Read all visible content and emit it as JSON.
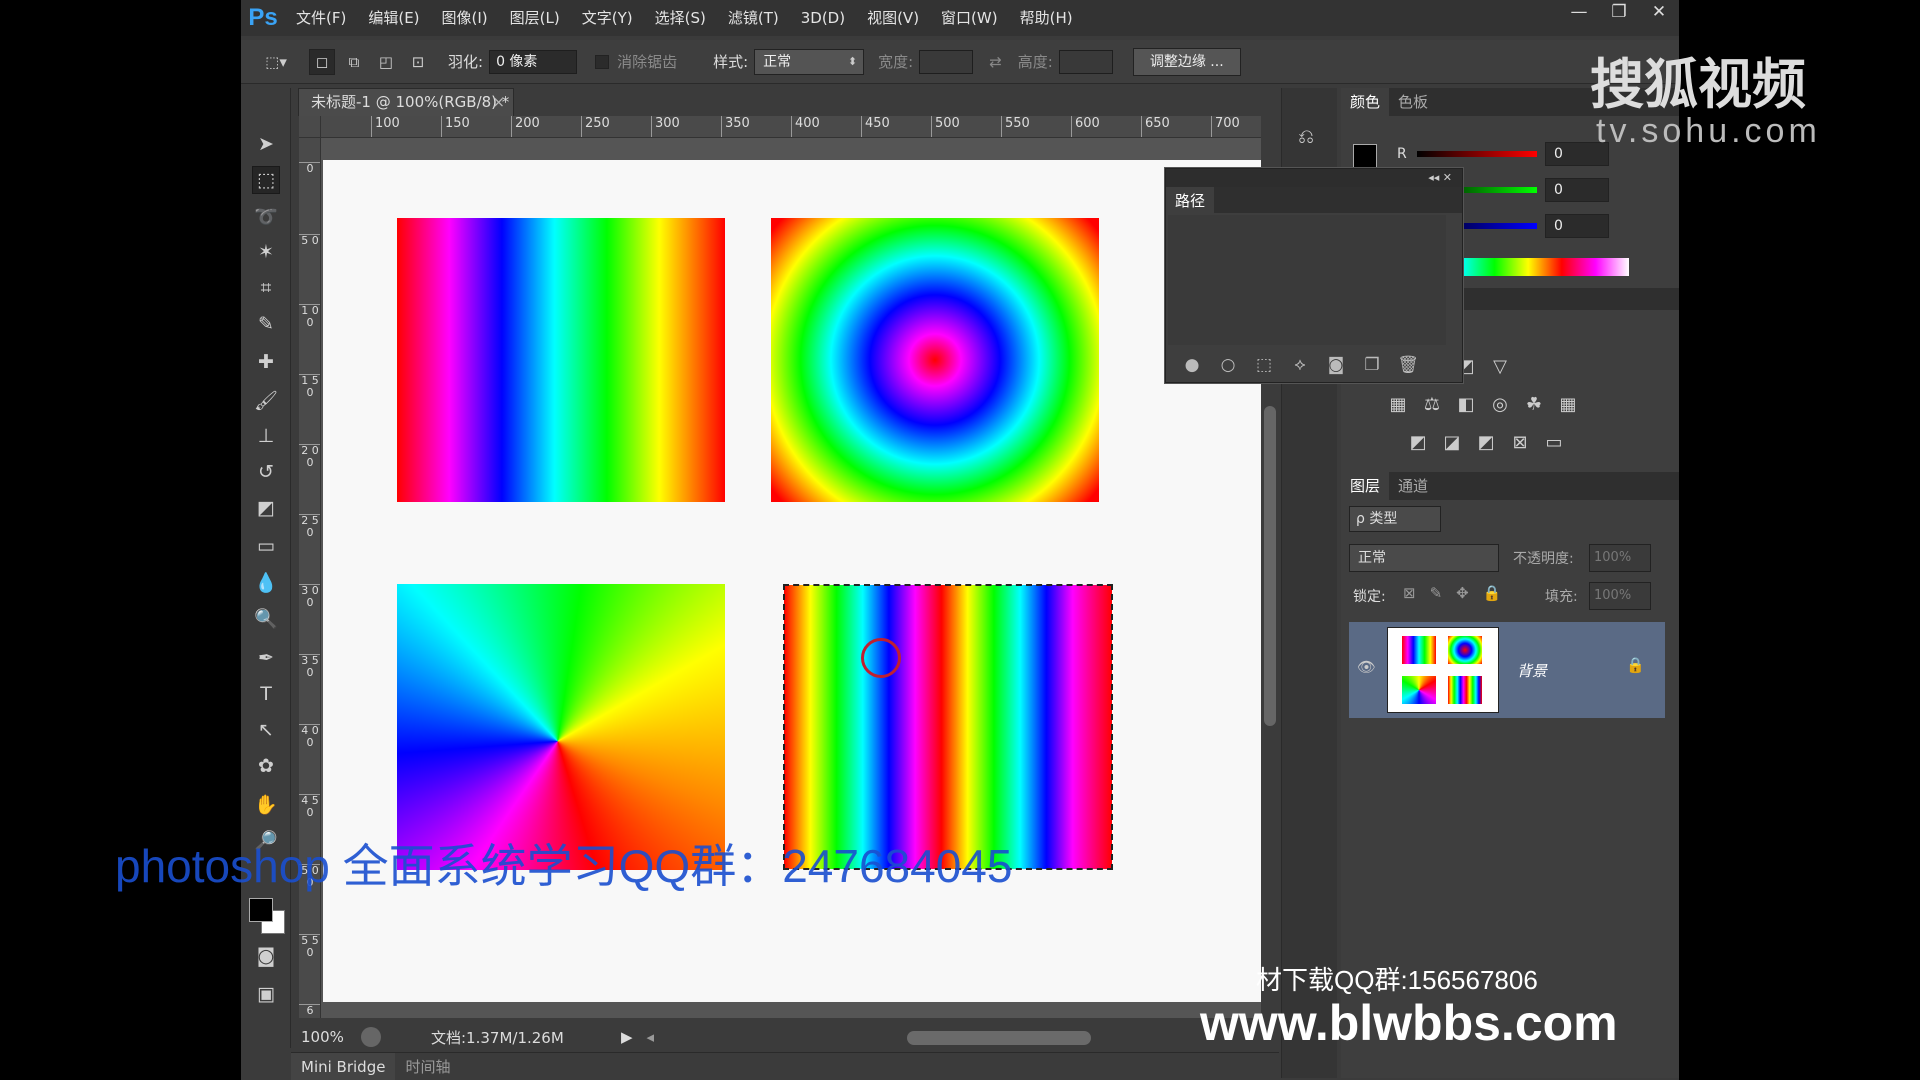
{
  "app": {
    "logo": "Ps",
    "menu": [
      "文件(F)",
      "编辑(E)",
      "图像(I)",
      "图层(L)",
      "文字(Y)",
      "选择(S)",
      "滤镜(T)",
      "3D(D)",
      "视图(V)",
      "窗口(W)",
      "帮助(H)"
    ],
    "window_controls": [
      "—",
      "❐",
      "✕"
    ]
  },
  "options": {
    "feather_label": "羽化:",
    "feather_value": "0 像素",
    "antialias_label": "消除锯齿",
    "style_label": "样式:",
    "style_value": "正常",
    "width_label": "宽度:",
    "height_label": "高度:",
    "refine_button": "调整边缘 ..."
  },
  "document": {
    "tab_title": "未标题-1 @ 100%(RGB/8) *",
    "tab_close": "×"
  },
  "ruler": {
    "h": [
      "100",
      "150",
      "200",
      "250",
      "300",
      "350",
      "400",
      "450",
      "500",
      "550",
      "600",
      "650",
      "700"
    ],
    "v": [
      "0",
      "5 0",
      "1 0 0",
      "1 5 0",
      "2 0 0",
      "2 5 0",
      "3 0 0",
      "3 5 0",
      "4 0 0",
      "4 5 0",
      "5 0 0",
      "5 5 0",
      "6"
    ]
  },
  "status": {
    "zoom": "100%",
    "doc_info": "文档:1.37M/1.26M"
  },
  "bottom_tabs": [
    "Mini Bridge",
    "时间轴"
  ],
  "color_panel": {
    "tabs": [
      "颜色",
      "色板"
    ],
    "r_label": "R",
    "r": "0",
    "g": "0",
    "b": "0"
  },
  "paths_panel": {
    "title": "路径"
  },
  "layers_panel": {
    "tabs": [
      "图层",
      "通道"
    ],
    "filter_label": "ρ 类型",
    "blend_mode": "正常",
    "opacity_label": "不透明度:",
    "opacity_value": "100%",
    "lock_label": "锁定:",
    "fill_label": "填充:",
    "fill_value": "100%",
    "layer_name": "背景"
  },
  "overlay": {
    "qq_group": "photoshop 全面系统学习QQ群：247684045",
    "sohu_logo": "搜狐视频",
    "sohu_url": "tv.sohu.com",
    "download_qq": "材下载QQ群:156567806",
    "site": "www.blwbbs.com"
  }
}
